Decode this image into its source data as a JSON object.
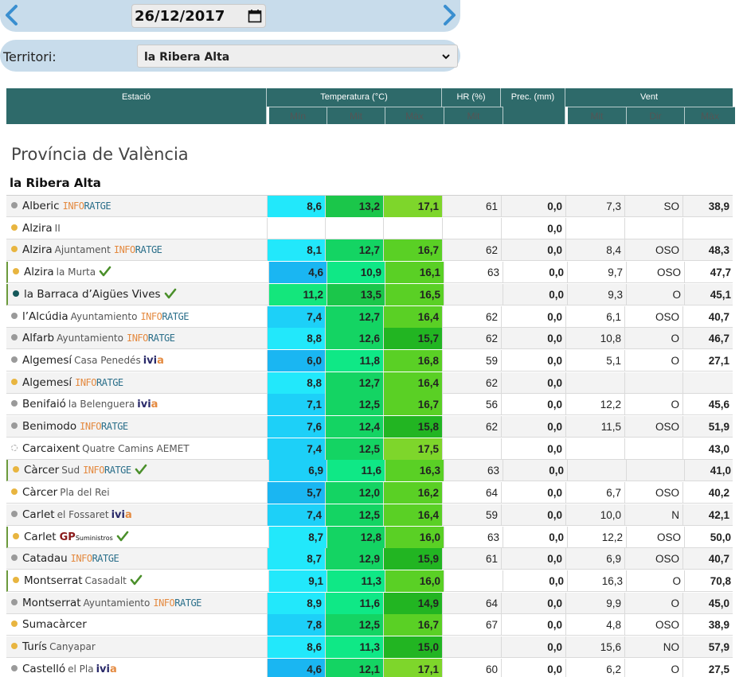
{
  "date": {
    "value": "26/12/2017"
  },
  "territory": {
    "label": "Territori:",
    "selected": "la Ribera Alta"
  },
  "header": {
    "estacio": "Estació",
    "temperatura": "Temperatura (°C)",
    "hr": "HR (%)",
    "prec": "Prec. (mm)",
    "vent": "Vent",
    "min": "Mín",
    "mit_t": "Mit",
    "max_t": "Màx",
    "mit_hr": "Mit",
    "mit_v": "Mit",
    "dir": "Dir",
    "max_v": "Màx"
  },
  "province": "Província de València",
  "comarca": "la Ribera Alta",
  "colors": {
    "header_bg": "#2e6a6a",
    "accent_bar": "#c8dceb",
    "check_green": "#4a8f2a"
  },
  "stations": [
    {
      "name": "Alberic",
      "sub": "",
      "logo": "info",
      "check": false,
      "dot": "grey",
      "min": "8,6",
      "mit": "13,2",
      "max": "17,1",
      "hr": "61",
      "prec": "0,0",
      "vmit": "7,3",
      "dir": "SO",
      "vmax": "38,9"
    },
    {
      "name": "Alzira",
      "sub": "II",
      "logo": "",
      "check": false,
      "dot": "yellow",
      "min": "",
      "mit": "",
      "max": "",
      "hr": "",
      "prec": "0,0",
      "vmit": "",
      "dir": "",
      "vmax": ""
    },
    {
      "name": "Alzira",
      "sub": "Ajuntament",
      "logo": "info",
      "check": false,
      "dot": "yellow",
      "min": "8,1",
      "mit": "12,7",
      "max": "16,7",
      "hr": "62",
      "prec": "0,0",
      "vmit": "8,4",
      "dir": "OSO",
      "vmax": "48,3"
    },
    {
      "name": "Alzira",
      "sub": "la Murta",
      "logo": "",
      "check": true,
      "dot": "yellow",
      "min": "4,6",
      "mit": "10,9",
      "max": "16,1",
      "hr": "63",
      "prec": "0,0",
      "vmit": "9,7",
      "dir": "OSO",
      "vmax": "47,7"
    },
    {
      "name": "la Barraca d’Aigües Vives",
      "sub": "",
      "logo": "",
      "check": true,
      "dot": "teal",
      "min": "11,2",
      "mit": "13,5",
      "max": "16,5",
      "hr": "",
      "prec": "0,0",
      "vmit": "9,3",
      "dir": "O",
      "vmax": "45,1"
    },
    {
      "name": "l’Alcúdia",
      "sub": "Ayuntamiento",
      "logo": "info",
      "check": false,
      "dot": "grey",
      "min": "7,4",
      "mit": "12,7",
      "max": "16,4",
      "hr": "62",
      "prec": "0,0",
      "vmit": "6,1",
      "dir": "OSO",
      "vmax": "40,7"
    },
    {
      "name": "Alfarb",
      "sub": "Ayuntamiento",
      "logo": "info",
      "check": false,
      "dot": "grey",
      "min": "8,8",
      "mit": "12,6",
      "max": "15,7",
      "hr": "62",
      "prec": "0,0",
      "vmit": "10,8",
      "dir": "O",
      "vmax": "46,7"
    },
    {
      "name": "Algemesí",
      "sub": "Casa Penedés",
      "logo": "ivia",
      "check": false,
      "dot": "grey",
      "min": "6,0",
      "mit": "11,8",
      "max": "16,8",
      "hr": "59",
      "prec": "0,0",
      "vmit": "5,1",
      "dir": "O",
      "vmax": "27,1"
    },
    {
      "name": "Algemesí",
      "sub": "",
      "logo": "info",
      "check": false,
      "dot": "yellow",
      "min": "8,8",
      "mit": "12,7",
      "max": "16,4",
      "hr": "62",
      "prec": "0,0",
      "vmit": "",
      "dir": "",
      "vmax": ""
    },
    {
      "name": "Benifaió",
      "sub": "la Belenguera",
      "logo": "ivia",
      "check": false,
      "dot": "grey",
      "min": "7,1",
      "mit": "12,5",
      "max": "16,7",
      "hr": "56",
      "prec": "0,0",
      "vmit": "12,2",
      "dir": "O",
      "vmax": "45,6"
    },
    {
      "name": "Benimodo",
      "sub": "",
      "logo": "info",
      "check": false,
      "dot": "grey",
      "min": "7,6",
      "mit": "12,4",
      "max": "15,8",
      "hr": "62",
      "prec": "0,0",
      "vmit": "11,5",
      "dir": "OSO",
      "vmax": "51,9"
    },
    {
      "name": "Carcaixent",
      "sub": "Quatre Camins AEMET",
      "logo": "",
      "check": false,
      "dot": "hollow",
      "min": "7,4",
      "mit": "12,5",
      "max": "17,5",
      "hr": "",
      "prec": "0,0",
      "vmit": "",
      "dir": "",
      "vmax": "43,0"
    },
    {
      "name": "Càrcer",
      "sub": "Sud",
      "logo": "info",
      "check": true,
      "dot": "yellow",
      "min": "6,9",
      "mit": "11,6",
      "max": "16,3",
      "hr": "63",
      "prec": "0,0",
      "vmit": "",
      "dir": "",
      "vmax": "41,0"
    },
    {
      "name": "Càrcer",
      "sub": "Pla del Rei",
      "logo": "",
      "check": false,
      "dot": "yellow",
      "min": "5,7",
      "mit": "12,0",
      "max": "16,2",
      "hr": "64",
      "prec": "0,0",
      "vmit": "6,7",
      "dir": "OSO",
      "vmax": "40,2"
    },
    {
      "name": "Carlet",
      "sub": "el Fossaret",
      "logo": "ivia",
      "check": false,
      "dot": "grey",
      "min": "7,4",
      "mit": "12,5",
      "max": "16,4",
      "hr": "59",
      "prec": "0,0",
      "vmit": "10,0",
      "dir": "N",
      "vmax": "42,1"
    },
    {
      "name": "Carlet",
      "sub": "",
      "logo": "gp",
      "check": true,
      "dot": "yellow",
      "min": "8,7",
      "mit": "12,8",
      "max": "16,0",
      "hr": "63",
      "prec": "0,0",
      "vmit": "12,2",
      "dir": "OSO",
      "vmax": "50,0"
    },
    {
      "name": "Catadau",
      "sub": "",
      "logo": "info",
      "check": false,
      "dot": "grey",
      "min": "8,7",
      "mit": "12,9",
      "max": "15,9",
      "hr": "61",
      "prec": "0,0",
      "vmit": "6,9",
      "dir": "OSO",
      "vmax": "40,7"
    },
    {
      "name": "Montserrat",
      "sub": "Casadalt",
      "logo": "",
      "check": true,
      "dot": "yellow",
      "min": "9,1",
      "mit": "11,3",
      "max": "16,0",
      "hr": "",
      "prec": "0,0",
      "vmit": "16,3",
      "dir": "O",
      "vmax": "70,8"
    },
    {
      "name": "Montserrat",
      "sub": "Ayuntamiento",
      "logo": "info",
      "check": false,
      "dot": "grey",
      "min": "8,9",
      "mit": "11,6",
      "max": "14,9",
      "hr": "64",
      "prec": "0,0",
      "vmit": "9,9",
      "dir": "O",
      "vmax": "45,0"
    },
    {
      "name": "Sumacàrcer",
      "sub": "",
      "logo": "",
      "check": false,
      "dot": "yellow",
      "min": "7,8",
      "mit": "12,5",
      "max": "16,7",
      "hr": "67",
      "prec": "0,0",
      "vmit": "4,8",
      "dir": "OSO",
      "vmax": "38,9"
    },
    {
      "name": "Turís",
      "sub": "Canyapar",
      "logo": "",
      "check": false,
      "dot": "yellow",
      "min": "8,6",
      "mit": "11,3",
      "max": "15,0",
      "hr": "",
      "prec": "0,0",
      "vmit": "15,6",
      "dir": "NO",
      "vmax": "57,9"
    },
    {
      "name": "Castelló",
      "sub": "el Pla",
      "logo": "ivia",
      "check": false,
      "dot": "grey",
      "min": "4,6",
      "mit": "12,1",
      "max": "17,1",
      "hr": "60",
      "prec": "0,0",
      "vmit": "6,2",
      "dir": "O",
      "vmax": "27,5"
    }
  ],
  "logos": {
    "info_a": "INFO",
    "info_b": "RATGE",
    "ivia_a": "ivi",
    "ivia_b": "a",
    "gp": "GP",
    "gp_small": "Suministros"
  }
}
